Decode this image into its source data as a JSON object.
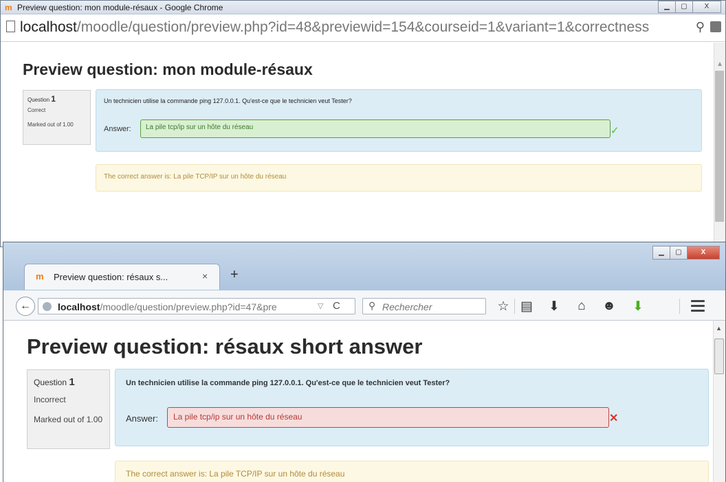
{
  "chrome": {
    "title": "Preview question: mon module-résaux - Google Chrome",
    "url_host": "localhost",
    "url_rest": "/moodle/question/preview.php?id=48&previewid=154&courseid=1&variant=1&correctness",
    "page_title": "Preview question: mon module-résaux",
    "question": {
      "qno_label": "Question",
      "qno": "1",
      "state": "Correct",
      "marked": "Marked out of 1.00",
      "text": "Un technicien utilise la commande ping 127.0.0.1. Qu'est-ce que le technicien veut Tester?",
      "answer_label": "Answer:",
      "answer_value": "La pile tcp/ip sur un hôte du réseau",
      "correct_answer": "The correct answer is: La pile TCP/IP sur un hôte du réseau"
    }
  },
  "firefox": {
    "tab_title": "Preview question: résaux s...",
    "tab_close": "×",
    "new_tab": "+",
    "url_host": "localhost",
    "url_rest": "/moodle/question/preview.php?id=47&pre",
    "search_placeholder": "Rechercher",
    "page_title": "Preview question: résaux short answer",
    "question": {
      "qno_label": "Question",
      "qno": "1",
      "state": "Incorrect",
      "marked": "Marked out of 1.00",
      "text": "Un technicien utilise la commande ping 127.0.0.1. Qu'est-ce que le technicien veut Tester?",
      "answer_label": "Answer:",
      "answer_value": "La pile tcp/ip sur un hôte du réseau",
      "correct_answer": "The correct answer is: La pile TCP/IP sur un hôte du réseau"
    },
    "toolbar_icons": [
      "star-icon",
      "reading-list-icon",
      "download-icon",
      "home-icon",
      "chat-icon",
      "addon-download-icon",
      "menu-icon"
    ]
  },
  "colors": {
    "correct_bg": "#d9efd2",
    "correct_border": "#54a33a",
    "incorrect_bg": "#f6dddc",
    "incorrect_border": "#b54b47",
    "formulation_bg": "#dcedf6",
    "outcome_bg": "#fcf8e3",
    "moodle_orange": "#f07b14"
  }
}
